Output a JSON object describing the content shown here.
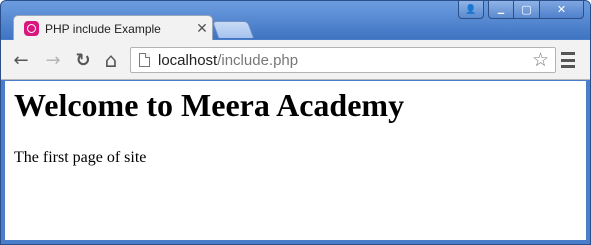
{
  "browser": {
    "tab": {
      "title": "PHP include Example",
      "close_glyph": "✕",
      "favicon": "wamp-icon"
    },
    "window_controls": {
      "user_glyph": "👤",
      "minimize_glyph": "▁",
      "maximize_glyph": "▢",
      "close_glyph": "✕"
    },
    "nav": {
      "back_glyph": "←",
      "forward_glyph": "→",
      "reload_glyph": "↻",
      "home_glyph": "⌂"
    },
    "address": {
      "host": "localhost",
      "path": "/include.php",
      "star_glyph": "☆"
    },
    "colors": {
      "frame": "#4a7ec9",
      "favicon": "#d7187f"
    }
  },
  "page": {
    "heading": "Welcome to Meera Academy",
    "paragraph": "The first page of site"
  }
}
